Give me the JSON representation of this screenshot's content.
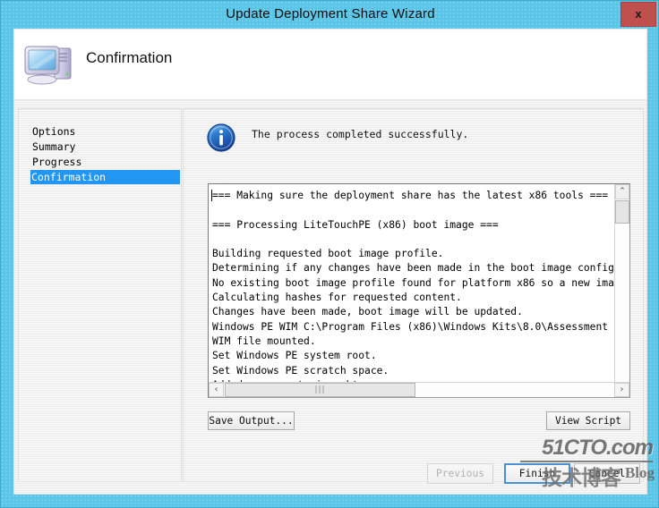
{
  "window": {
    "title": "Update Deployment Share Wizard",
    "close_label": "x",
    "accent_color": "#5bc5e8",
    "close_color": "#c0504d"
  },
  "header": {
    "title": "Confirmation",
    "icon": "computer-icon"
  },
  "sidebar": {
    "items": [
      {
        "label": "Options",
        "selected": false
      },
      {
        "label": "Summary",
        "selected": false
      },
      {
        "label": "Progress",
        "selected": false
      },
      {
        "label": "Confirmation",
        "selected": true
      }
    ],
    "selected_color": "#2196f3"
  },
  "info": {
    "icon": "info-icon",
    "message": "The process completed successfully."
  },
  "log": {
    "text": "=== Making sure the deployment share has the latest x86 tools ===\n\n=== Processing LiteTouchPE (x86) boot image ===\n\nBuilding requested boot image profile.\nDetermining if any changes have been made in the boot image configuration.\nNo existing boot image profile found for platform x86 so a new image will be cr\nCalculating hashes for requested content.\nChanges have been made, boot image will be updated.\nWindows PE WIM C:\\Program Files (x86)\\Windows Kits\\8.0\\Assessment and Deploymen\nWIM file mounted.\nSet Windows PE system root.\nSet Windows PE scratch space.\nAdded component winpe-hta\nAdded component winpe-scripting",
    "vscroll_up_glyph": "⌃",
    "vscroll_down_glyph": "⌄",
    "hscroll_left_glyph": "‹",
    "hscroll_right_glyph": "›",
    "hscroll_grip_glyph": "|||"
  },
  "log_actions": {
    "save_output_label": "Save Output...",
    "view_script_label": "View Script"
  },
  "footer": {
    "previous_label": "Previous",
    "previous_disabled": true,
    "finish_label": "Finish",
    "finish_default": true,
    "cancel_label": "Cancel"
  },
  "watermark": {
    "line1": "51CTO.com",
    "line2": "技术博客",
    "line3": "Blog"
  }
}
